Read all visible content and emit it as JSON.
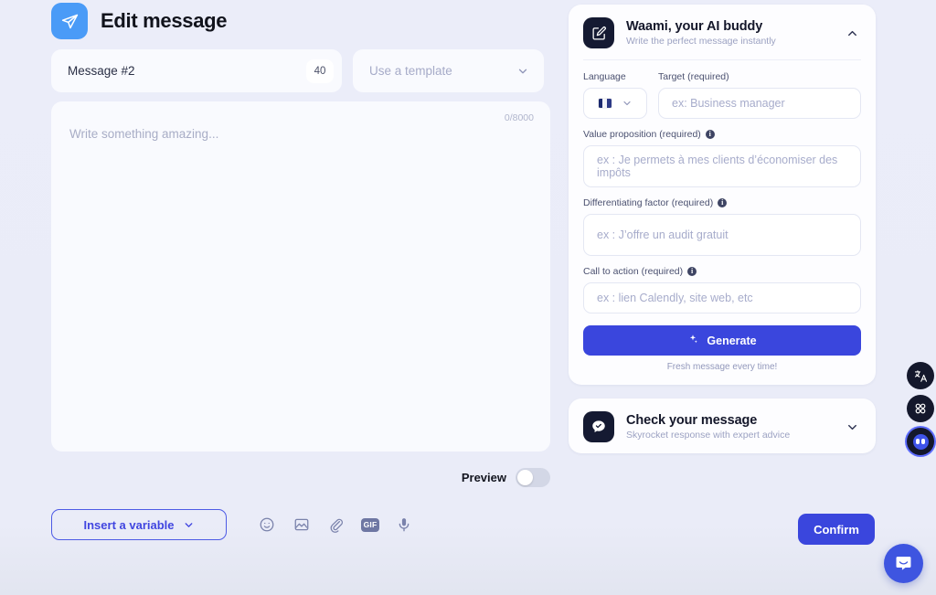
{
  "header": {
    "title": "Edit message",
    "icon": "paper-plane-icon"
  },
  "message_name": {
    "value": "Message #2",
    "char_badge": "40"
  },
  "template_select": {
    "placeholder": "Use a template",
    "chevron": "chevron-down-icon"
  },
  "editor": {
    "placeholder": "Write something amazing...",
    "counter": "0/8000"
  },
  "preview": {
    "label": "Preview",
    "enabled": false
  },
  "toolbar": {
    "insert_variable_label": "Insert a variable",
    "icons": [
      {
        "name": "emoji-icon",
        "label": "Emoji"
      },
      {
        "name": "image-icon",
        "label": "Image"
      },
      {
        "name": "attachment-icon",
        "label": "Attachment"
      },
      {
        "name": "gif-icon",
        "label": "GIF"
      },
      {
        "name": "microphone-icon",
        "label": "Voice note"
      }
    ],
    "gif_text": "GIF",
    "confirm_label": "Confirm"
  },
  "ai_panel": {
    "title": "Waami, your AI buddy",
    "subtitle": "Write the perfect message instantly",
    "icon": "pencil-square-icon",
    "chevron": "chevron-up-icon",
    "expanded": true,
    "fields": {
      "language": {
        "label": "Language",
        "selected_flag": "flag-france",
        "chevron": "chevron-down-icon"
      },
      "target": {
        "label": "Target (required)",
        "placeholder": "ex: Business manager",
        "value": ""
      },
      "value_proposition": {
        "label": "Value proposition (required)",
        "info": "i",
        "placeholder": "ex : Je permets à mes clients d’économiser des impôts",
        "value": ""
      },
      "differentiating_factor": {
        "label": "Differentiating factor (required)",
        "info": "i",
        "placeholder": "ex : J’offre un audit gratuit",
        "value": ""
      },
      "call_to_action": {
        "label": "Call to action (required)",
        "info": "i",
        "placeholder": "ex : lien Calendly, site web, etc",
        "value": ""
      }
    },
    "generate_label": "Generate",
    "generate_caption": "Fresh message every time!"
  },
  "check_panel": {
    "title": "Check your message",
    "subtitle": "Skyrocket response with expert advice",
    "icon": "chat-check-icon",
    "chevron": "chevron-down-icon",
    "expanded": false
  },
  "rail": [
    {
      "name": "translate-icon",
      "label": "Translate"
    },
    {
      "name": "apps-grid-icon",
      "label": "Apps"
    },
    {
      "name": "ninja-mascot-icon",
      "label": "Assistant",
      "active": true
    }
  ],
  "intercom": {
    "name": "chat-launcher-icon",
    "label": "Open chat"
  },
  "colors": {
    "accent": "#3a46dd",
    "plane_badge": "#4a9bf7",
    "panel_badge": "#151a32",
    "background": "#eaecf8"
  }
}
